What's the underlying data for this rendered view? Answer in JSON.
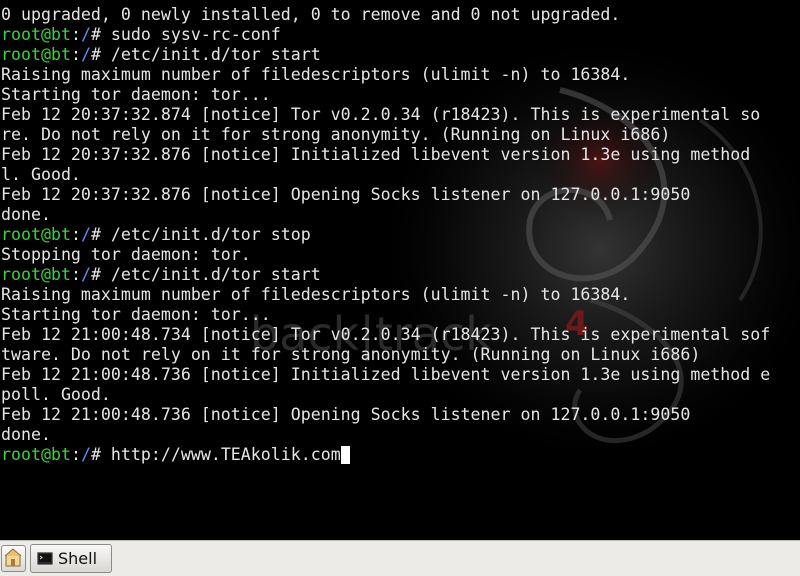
{
  "terminal": {
    "background_art": {
      "watermark_text": "back|track",
      "version_mark": "4"
    },
    "lines": [
      {
        "kind": "output",
        "text": "0 upgraded, 0 newly installed, 0 to remove and 0 not upgraded."
      },
      {
        "kind": "prompt",
        "user": "root@bt",
        "sep": ":",
        "path": "/",
        "symbol": "# ",
        "cmd": "sudo sysv-rc-conf"
      },
      {
        "kind": "prompt",
        "user": "root@bt",
        "sep": ":",
        "path": "/",
        "symbol": "# ",
        "cmd": "/etc/init.d/tor start"
      },
      {
        "kind": "output",
        "text": "Raising maximum number of filedescriptors (ulimit -n) to 16384."
      },
      {
        "kind": "output",
        "text": "Starting tor daemon: tor..."
      },
      {
        "kind": "output",
        "text": "Feb 12 20:37:32.874 [notice] Tor v0.2.0.34 (r18423). This is experimental so"
      },
      {
        "kind": "output",
        "text": "re. Do not rely on it for strong anonymity. (Running on Linux i686)"
      },
      {
        "kind": "output",
        "text": "Feb 12 20:37:32.876 [notice] Initialized libevent version 1.3e using method"
      },
      {
        "kind": "output",
        "text": "l. Good."
      },
      {
        "kind": "output",
        "text": "Feb 12 20:37:32.876 [notice] Opening Socks listener on 127.0.0.1:9050"
      },
      {
        "kind": "output",
        "text": "done."
      },
      {
        "kind": "prompt",
        "user": "root@bt",
        "sep": ":",
        "path": "/",
        "symbol": "# ",
        "cmd": "/etc/init.d/tor stop"
      },
      {
        "kind": "output",
        "text": "Stopping tor daemon: tor."
      },
      {
        "kind": "prompt",
        "user": "root@bt",
        "sep": ":",
        "path": "/",
        "symbol": "# ",
        "cmd": "/etc/init.d/tor start"
      },
      {
        "kind": "output",
        "text": "Raising maximum number of filedescriptors (ulimit -n) to 16384."
      },
      {
        "kind": "output",
        "text": "Starting tor daemon: tor..."
      },
      {
        "kind": "output",
        "text": "Feb 12 21:00:48.734 [notice] Tor v0.2.0.34 (r18423). This is experimental sof"
      },
      {
        "kind": "output",
        "text": "tware. Do not rely on it for strong anonymity. (Running on Linux i686)"
      },
      {
        "kind": "output",
        "text": "Feb 12 21:00:48.736 [notice] Initialized libevent version 1.3e using method e"
      },
      {
        "kind": "output",
        "text": "poll. Good."
      },
      {
        "kind": "output",
        "text": "Feb 12 21:00:48.736 [notice] Opening Socks listener on 127.0.0.1:9050"
      },
      {
        "kind": "output",
        "text": "done."
      },
      {
        "kind": "prompt",
        "user": "root@bt",
        "sep": ":",
        "path": "/",
        "symbol": "# ",
        "cmd": "http://www.TEAkolik.com",
        "cursor": true
      }
    ]
  },
  "taskbar": {
    "launcher_icon": "home-folder-icon",
    "tasks": [
      {
        "label": "Shell",
        "icon": "terminal-icon"
      }
    ]
  },
  "colors": {
    "prompt_user": "#3bd13b",
    "prompt_path": "#5f8ff0",
    "terminal_text": "#e6e6e6",
    "terminal_bg": "#000000"
  }
}
